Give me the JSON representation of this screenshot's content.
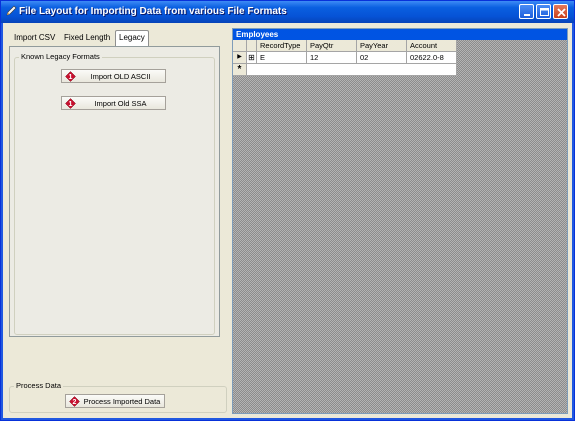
{
  "window": {
    "title": "File Layout for Importing Data from various File Formats"
  },
  "tabs": [
    {
      "label": "Import CSV"
    },
    {
      "label": "Fixed Length"
    },
    {
      "label": "Legacy"
    }
  ],
  "legacy": {
    "group_label": "Known Legacy Formats",
    "buttons": [
      {
        "label": "Import OLD ASCII",
        "icon_glyph": "1"
      },
      {
        "label": "Import Old SSA",
        "icon_glyph": "1"
      }
    ]
  },
  "process": {
    "group_label": "Process Data",
    "button_label": "Process Imported Data",
    "icon_glyph": "2"
  },
  "grid": {
    "caption": "Employees",
    "columns": [
      "RecordType",
      "PayQtr",
      "PayYear",
      "Account"
    ],
    "rows": [
      {
        "expand_glyph": "⊞",
        "cells": [
          "E",
          "12",
          "02",
          "02622.0-8"
        ]
      }
    ],
    "current_row_glyph": "▶",
    "new_row_glyph": "*"
  },
  "colors": {
    "title_bar": "#0653d6",
    "grid_caption": "#0054e3",
    "badge_red": "#c8102e"
  }
}
